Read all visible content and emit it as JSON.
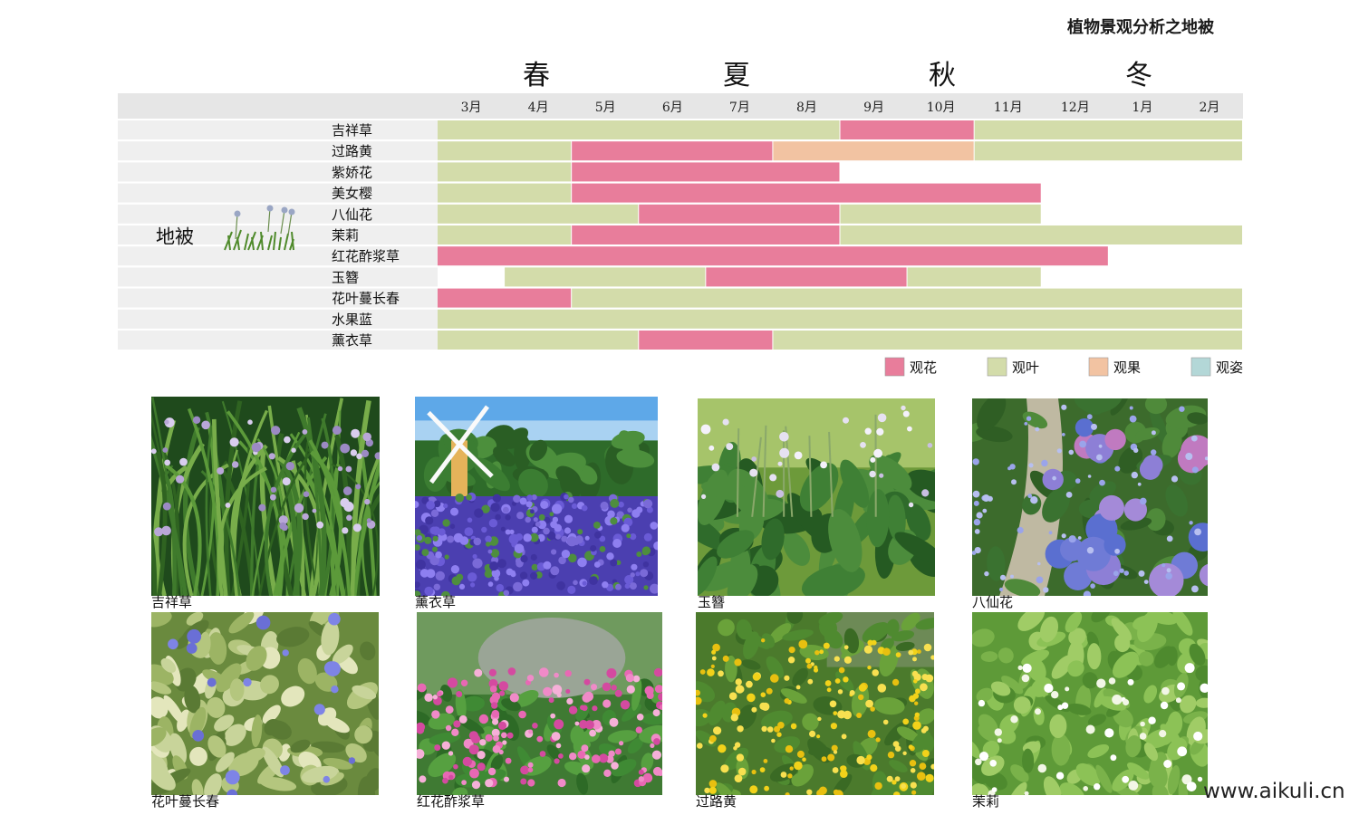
{
  "header": {
    "title": "植物景观分析之地被"
  },
  "chart_data": {
    "type": "gantt",
    "title": "",
    "seasons": [
      "春",
      "夏",
      "秋",
      "冬"
    ],
    "months": [
      "3月",
      "4月",
      "5月",
      "6月",
      "7月",
      "8月",
      "9月",
      "10月",
      "11月",
      "12月",
      "1月",
      "2月"
    ],
    "category": "地被",
    "category_icon": "grass-flower-icon",
    "legend": [
      {
        "key": "flower",
        "label": "观花",
        "color": "#e87d9b"
      },
      {
        "key": "leaf",
        "label": "观叶",
        "color": "#d3dcaa"
      },
      {
        "key": "fruit",
        "label": "观果",
        "color": "#f2c3a2"
      },
      {
        "key": "form",
        "label": "观姿",
        "color": "#b3d7d7"
      }
    ],
    "plants": [
      {
        "name": "吉祥草",
        "segments": [
          {
            "type": "leaf",
            "start": 0,
            "end": 6
          },
          {
            "type": "flower",
            "start": 6,
            "end": 8
          },
          {
            "type": "leaf",
            "start": 8,
            "end": 12
          }
        ]
      },
      {
        "name": "过路黄",
        "segments": [
          {
            "type": "leaf",
            "start": 0,
            "end": 2
          },
          {
            "type": "flower",
            "start": 2,
            "end": 5
          },
          {
            "type": "fruit",
            "start": 5,
            "end": 8
          },
          {
            "type": "leaf",
            "start": 8,
            "end": 12
          }
        ]
      },
      {
        "name": "紫娇花",
        "segments": [
          {
            "type": "leaf",
            "start": 0,
            "end": 2
          },
          {
            "type": "flower",
            "start": 2,
            "end": 6
          }
        ]
      },
      {
        "name": "美女樱",
        "segments": [
          {
            "type": "leaf",
            "start": 0,
            "end": 2
          },
          {
            "type": "flower",
            "start": 2,
            "end": 9
          }
        ]
      },
      {
        "name": "八仙花",
        "segments": [
          {
            "type": "leaf",
            "start": 0,
            "end": 3
          },
          {
            "type": "flower",
            "start": 3,
            "end": 6
          },
          {
            "type": "leaf",
            "start": 6,
            "end": 9
          }
        ]
      },
      {
        "name": "茉莉",
        "segments": [
          {
            "type": "leaf",
            "start": 0,
            "end": 2
          },
          {
            "type": "flower",
            "start": 2,
            "end": 6
          },
          {
            "type": "leaf",
            "start": 6,
            "end": 12
          }
        ]
      },
      {
        "name": "红花酢浆草",
        "segments": [
          {
            "type": "flower",
            "start": 0,
            "end": 10
          }
        ]
      },
      {
        "name": "玉簪",
        "segments": [
          {
            "type": "leaf",
            "start": 1,
            "end": 4
          },
          {
            "type": "flower",
            "start": 4,
            "end": 7
          },
          {
            "type": "leaf",
            "start": 7,
            "end": 9
          }
        ]
      },
      {
        "name": "花叶蔓长春",
        "segments": [
          {
            "type": "flower",
            "start": 0,
            "end": 2
          },
          {
            "type": "leaf",
            "start": 2,
            "end": 12
          }
        ]
      },
      {
        "name": "水果蓝",
        "segments": [
          {
            "type": "leaf",
            "start": 0,
            "end": 12
          }
        ]
      },
      {
        "name": "薰衣草",
        "segments": [
          {
            "type": "leaf",
            "start": 0,
            "end": 3
          },
          {
            "type": "flower",
            "start": 3,
            "end": 5
          },
          {
            "type": "leaf",
            "start": 5,
            "end": 12
          }
        ]
      }
    ]
  },
  "photos": [
    {
      "caption": "吉祥草",
      "scene": "grass"
    },
    {
      "caption": "薰衣草",
      "scene": "lavender"
    },
    {
      "caption": "玉簪",
      "scene": "hosta"
    },
    {
      "caption": "八仙花",
      "scene": "hydrangea"
    },
    {
      "caption": "花叶蔓长春",
      "scene": "vinca"
    },
    {
      "caption": "红花酢浆草",
      "scene": "oxalis"
    },
    {
      "caption": "过路黄",
      "scene": "yellow"
    },
    {
      "caption": "茉莉",
      "scene": "jasmine"
    }
  ],
  "footer": {
    "watermark": "www.aikuli.cn"
  }
}
